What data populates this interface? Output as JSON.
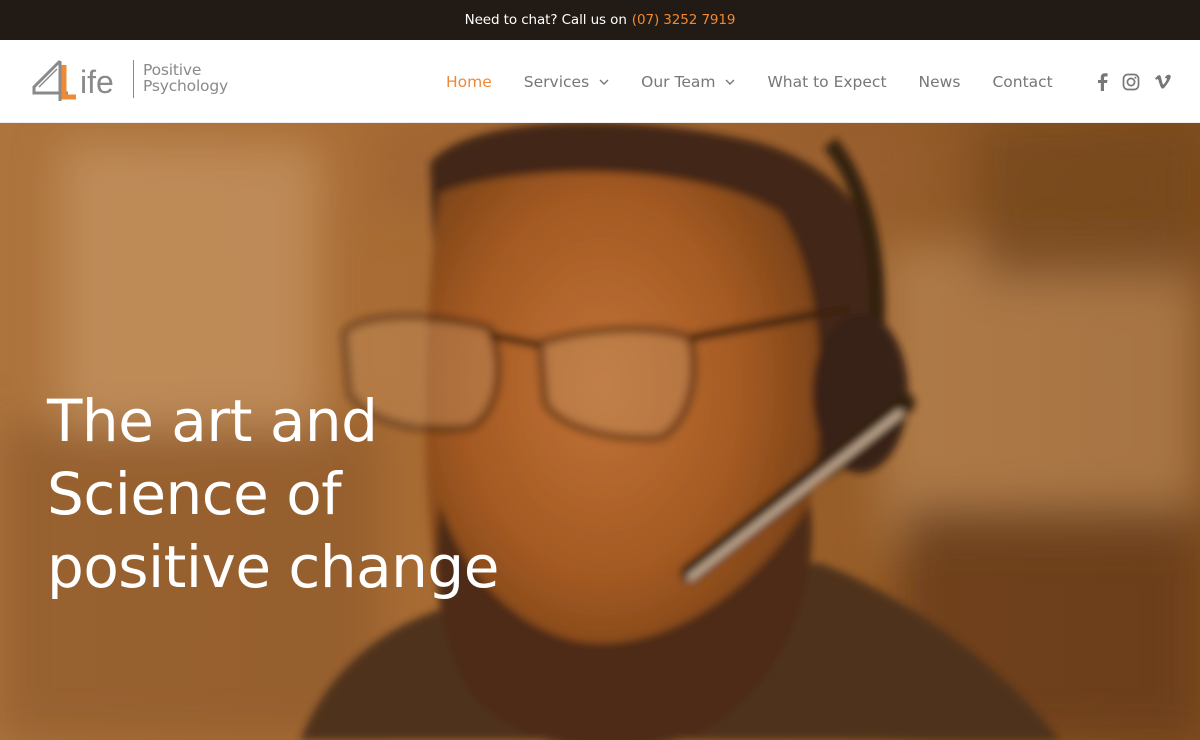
{
  "topbar": {
    "text": "Need to chat? Call us on",
    "phone": "(07) 3252 7919"
  },
  "brand": {
    "logo_mark": "4Life",
    "line1": "Positive",
    "line2": "Psychology",
    "accent_color": "#ec8a37"
  },
  "nav": {
    "items": [
      {
        "label": "Home",
        "active": true,
        "has_dropdown": false
      },
      {
        "label": "Services",
        "active": false,
        "has_dropdown": true
      },
      {
        "label": "Our Team",
        "active": false,
        "has_dropdown": true
      },
      {
        "label": "What to Expect",
        "active": false,
        "has_dropdown": false
      },
      {
        "label": "News",
        "active": false,
        "has_dropdown": false
      },
      {
        "label": "Contact",
        "active": false,
        "has_dropdown": false
      }
    ]
  },
  "social": {
    "icons": [
      "facebook-icon",
      "instagram-icon",
      "vimeo-icon"
    ]
  },
  "hero": {
    "title": "The art and\nScience of\npositive change",
    "image": "man-with-headset-photo"
  }
}
